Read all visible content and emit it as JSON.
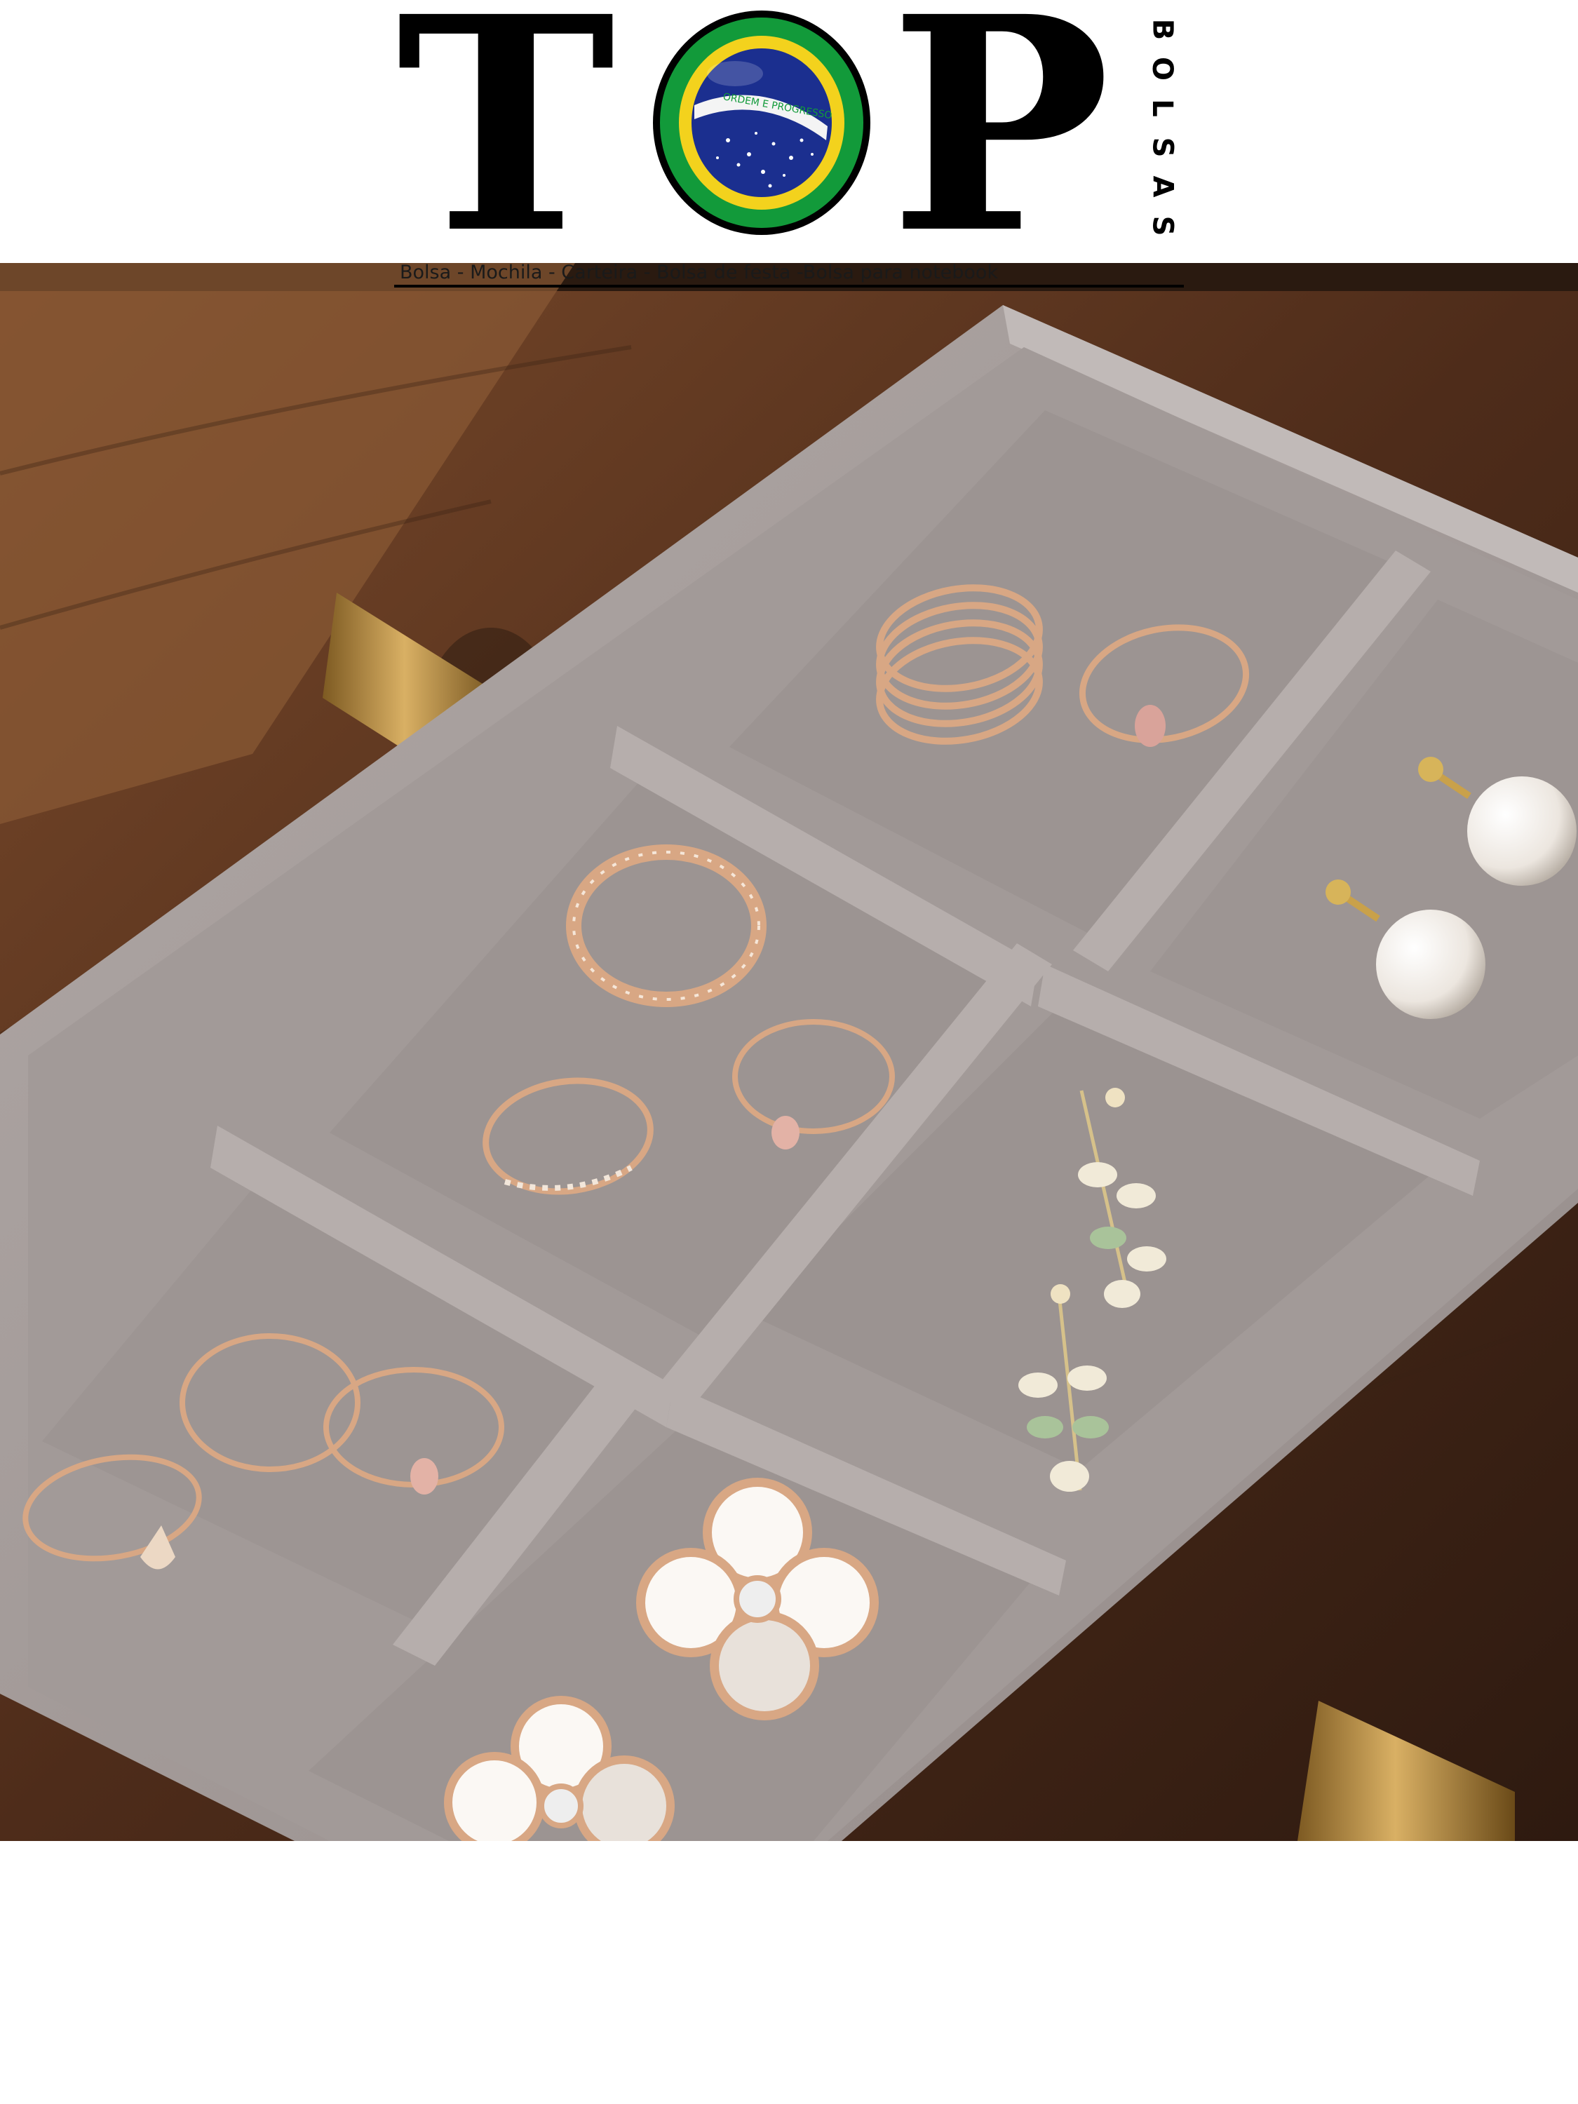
{
  "logo": {
    "letter_t": "T",
    "letter_p": "P",
    "emblem_band": "ORDEM E PROGRESSO",
    "brand_letters": [
      "B",
      "O",
      "L",
      "S",
      "A",
      "S"
    ],
    "tagline": "Bolsa - Mochila - Carteira - Bolsa de festa -Bolsa para notebook"
  },
  "colors": {
    "flag_green": "#129a3a",
    "flag_yellow": "#f3d21d",
    "flag_blue": "#1b2f8f",
    "tray_velvet": "#a49c9a",
    "wood": "#5a3420",
    "brass": "#b88a3a",
    "rose_gold": "#d8a784"
  },
  "photo": {
    "subject": "jewelry-tray",
    "icons": [
      "ring-icon",
      "pearl-earring-icon",
      "leaf-earring-icon",
      "flower-brooch-icon",
      "drawer-knob-icon"
    ]
  }
}
